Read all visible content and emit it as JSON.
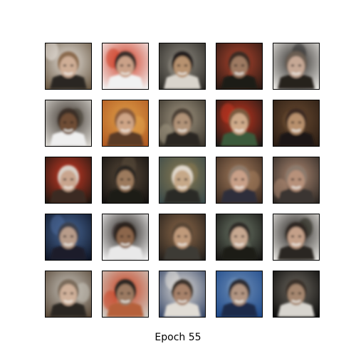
{
  "caption": "Epoch 55",
  "samples": [
    {
      "bg": "#6b5a45",
      "bg2": "#e9e4de",
      "face": "#cfae96",
      "hair": "#8a6a4e",
      "cloth": "#2a2622"
    },
    {
      "bg": "#f2f2f2",
      "bg2": "#cf3a22",
      "face": "#caa188",
      "hair": "#3a2f2a",
      "cloth": "#f1f1f1"
    },
    {
      "bg": "#2d2b27",
      "bg2": "#8f8a80",
      "face": "#b7926f",
      "hair": "#201d1a",
      "cloth": "#d9d4cc"
    },
    {
      "bg": "#2a1a14",
      "bg2": "#b3452e",
      "face": "#9e7a62",
      "hair": "#3a2c22",
      "cloth": "#1d1a18"
    },
    {
      "bg": "#e8e6e2",
      "bg2": "#2a2724",
      "face": "#c6a895",
      "hair": "#6c5e53",
      "cloth": "#25201d"
    },
    {
      "bg": "#d9d6d0",
      "bg2": "#3b332c",
      "face": "#6f4e36",
      "hair": "#3b2f27",
      "cloth": "#efefef"
    },
    {
      "bg": "#b15a22",
      "bg2": "#e2a24a",
      "face": "#cfa586",
      "hair": "#8b5b3a",
      "cloth": "#5a3a26"
    },
    {
      "bg": "#3a352c",
      "bg2": "#a69a85",
      "face": "#b19378",
      "hair": "#4b4136",
      "cloth": "#2a2622"
    },
    {
      "bg": "#1c1a17",
      "bg2": "#c8351e",
      "face": "#cfaa8a",
      "hair": "#7a5a3d",
      "cloth": "#3a5a3a"
    },
    {
      "bg": "#2a1d14",
      "bg2": "#6a4a30",
      "face": "#b8906d",
      "hair": "#3d2c20",
      "cloth": "#1c1713"
    },
    {
      "bg": "#1f1812",
      "bg2": "#d23a25",
      "face": "#c9a58e",
      "hair": "#d9d2c9",
      "cloth": "#3a2a20"
    },
    {
      "bg": "#141210",
      "bg2": "#5a4a3a",
      "face": "#9c7a5d",
      "hair": "#2a2520",
      "cloth": "#1b1a18"
    },
    {
      "bg": "#3a4a4a",
      "bg2": "#8a7a50",
      "face": "#c6a888",
      "hair": "#e0d8cc",
      "cloth": "#2c2a26"
    },
    {
      "bg": "#3a2a20",
      "bg2": "#a57d5d",
      "face": "#c9a088",
      "hair": "#8e7a6a",
      "cloth": "#2e2f3a"
    },
    {
      "bg": "#2d2824",
      "bg2": "#b08a73",
      "face": "#b7917a",
      "hair": "#8b7a6d",
      "cloth": "#3b3532"
    },
    {
      "bg": "#0f1626",
      "bg2": "#4a6a9a",
      "face": "#b89c8a",
      "hair": "#3a3f4e",
      "cloth": "#1a1d2a"
    },
    {
      "bg": "#f3f3f3",
      "bg2": "#1f1a16",
      "face": "#8c664c",
      "hair": "#2a231d",
      "cloth": "#e9e9e9"
    },
    {
      "bg": "#24201c",
      "bg2": "#8f6a4a",
      "face": "#c09a7a",
      "hair": "#5a4636",
      "cloth": "#3c3a36"
    },
    {
      "bg": "#161513",
      "bg2": "#6f7a6a",
      "face": "#c7a891",
      "hair": "#2f2a25",
      "cloth": "#1b1a18"
    },
    {
      "bg": "#e6e4e0",
      "bg2": "#1f1c19",
      "face": "#c4a089",
      "hair": "#2e2721",
      "cloth": "#2b2722"
    },
    {
      "bg": "#5a4a3a",
      "bg2": "#c8c4bc",
      "face": "#cfb09a",
      "hair": "#7a6a5a",
      "cloth": "#2a2622"
    },
    {
      "bg": "#cfcac2",
      "bg2": "#c8401f",
      "face": "#9b7a62",
      "hair": "#2b2520",
      "cloth": "#b5603a"
    },
    {
      "bg": "#3a4a6a",
      "bg2": "#e7e3dd",
      "face": "#a7826a",
      "hair": "#3a322b",
      "cloth": "#e1ddd6"
    },
    {
      "bg": "#1f4a8a",
      "bg2": "#6f8fb8",
      "face": "#b29582",
      "hair": "#2a2b30",
      "cloth": "#1a2a4a"
    },
    {
      "bg": "#0c0c0b",
      "bg2": "#6f6a62",
      "face": "#a68770",
      "hair": "#3a332c",
      "cloth": "#d8d5cf"
    }
  ]
}
